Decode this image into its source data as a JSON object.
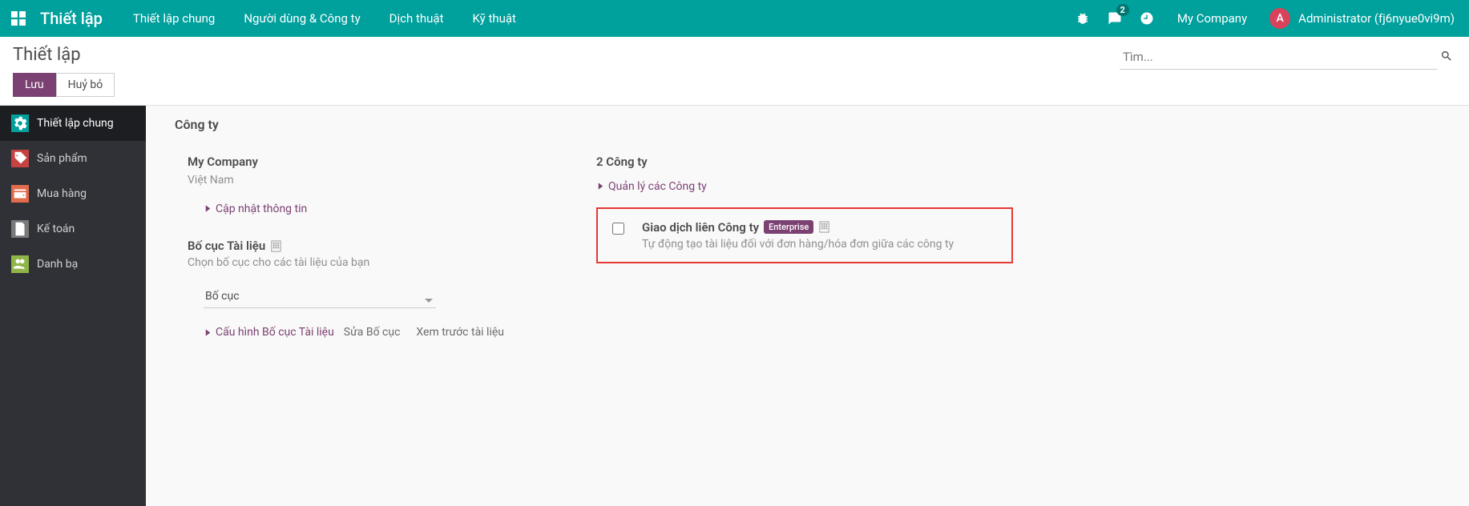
{
  "navbar": {
    "brand": "Thiết lập",
    "items": [
      "Thiết lập chung",
      "Người dùng & Công ty",
      "Dịch thuật",
      "Kỹ thuật"
    ],
    "msg_count": "2",
    "company": "My Company",
    "user_initial": "A",
    "user_name": "Administrator (fj6nyue0vi9m)"
  },
  "control": {
    "title": "Thiết lập",
    "save": "Lưu",
    "cancel": "Huỷ bỏ",
    "search_placeholder": "Tìm..."
  },
  "sidebar": {
    "items": [
      {
        "label": "Thiết lập chung"
      },
      {
        "label": "Sản phẩm"
      },
      {
        "label": "Mua hàng"
      },
      {
        "label": "Kế toán"
      },
      {
        "label": "Danh bạ"
      }
    ]
  },
  "section": {
    "header": "Công ty",
    "company_name": "My Company",
    "company_location": "Việt Nam",
    "update_info": "Cập nhật thông tin",
    "doc_layout_title": "Bố cục Tài liệu",
    "doc_layout_desc": "Chọn bố cục cho các tài liệu của bạn",
    "layout_select": "Bố cục",
    "config_layout": "Cấu hình Bố cục Tài liệu",
    "edit_layout": "Sửa Bố cục",
    "preview_doc": "Xem trước tài liệu",
    "companies_count": "2 Công ty",
    "manage_companies": "Quản lý các Công ty",
    "intercompany_title": "Giao dịch liên Công ty",
    "enterprise_badge": "Enterprise",
    "intercompany_desc": "Tự động tạo tài liệu đối với đơn hàng/hóa đơn giữa các công ty"
  }
}
